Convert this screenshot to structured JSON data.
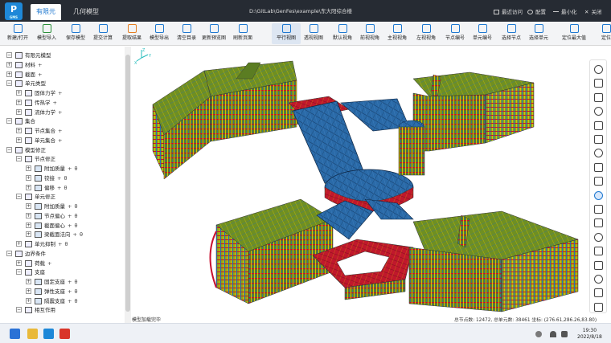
{
  "app": {
    "logo_text": "P",
    "logo_sub": "GMS",
    "tabs": [
      {
        "label": "有限元",
        "active": true
      },
      {
        "label": "几何模型",
        "active": false
      }
    ],
    "file_path": "D:\\GitLab\\GenFes\\example\\东大阳综合楼",
    "title_right": {
      "recent": "最近访问",
      "settings": "配置",
      "minimize": "最小化",
      "close": "关闭"
    }
  },
  "ribbon": {
    "buttons": [
      {
        "label": "新建/打开",
        "icon": "new-open-icon"
      },
      {
        "label": "模型导入",
        "icon": "import-icon"
      },
      {
        "label": "保存模型",
        "icon": "save-icon"
      },
      {
        "label": "提交计算",
        "icon": "submit-icon"
      },
      {
        "label": "提取结果",
        "icon": "extract-icon"
      },
      {
        "label": "模型导出",
        "icon": "export-icon"
      },
      {
        "label": "清空目录",
        "icon": "clear-icon"
      },
      {
        "label": "更新预览图",
        "icon": "update-preview-icon"
      },
      {
        "label": "刷新页面",
        "icon": "refresh-icon"
      },
      {
        "label": "平行视图",
        "icon": "parallel-view-icon"
      },
      {
        "label": "透视视图",
        "icon": "perspective-view-icon"
      },
      {
        "label": "默认视角",
        "icon": "default-view-icon"
      },
      {
        "label": "前视视角",
        "icon": "front-view-icon"
      },
      {
        "label": "主视视角",
        "icon": "main-view-icon"
      },
      {
        "label": "左视视角",
        "icon": "left-view-icon"
      },
      {
        "label": "节点编号",
        "icon": "node-number-icon"
      },
      {
        "label": "单元编号",
        "icon": "element-number-icon"
      },
      {
        "label": "选择节点",
        "icon": "select-node-icon"
      },
      {
        "label": "选择单元",
        "icon": "select-element-icon"
      },
      {
        "label": "定位最大值",
        "icon": "locate-max-icon"
      },
      {
        "label": "定位",
        "icon": "locate-icon"
      }
    ],
    "active_index": 9
  },
  "tree": {
    "items": [
      {
        "label": "有限元模型",
        "level": 0,
        "plus": false
      },
      {
        "label": "材料",
        "level": 0,
        "plus": true
      },
      {
        "label": "截面",
        "level": 0,
        "plus": true
      },
      {
        "label": "单元类型",
        "level": 0,
        "plus": false
      },
      {
        "label": "固体力学",
        "level": 1,
        "plus": true
      },
      {
        "label": "传热学",
        "level": 1,
        "plus": true
      },
      {
        "label": "流体力学",
        "level": 1,
        "plus": true
      },
      {
        "label": "集合",
        "level": 0,
        "plus": false
      },
      {
        "label": "节点集合",
        "level": 1,
        "plus": true
      },
      {
        "label": "单元集合",
        "level": 1,
        "plus": true
      },
      {
        "label": "模型修正",
        "level": 0,
        "plus": false
      },
      {
        "label": "节点修正",
        "level": 1,
        "plus": false
      },
      {
        "label": "附加质量",
        "level": 2,
        "plus": true,
        "extra": "θ"
      },
      {
        "label": "铰接",
        "level": 2,
        "plus": true,
        "extra": "θ"
      },
      {
        "label": "偏移",
        "level": 2,
        "plus": true,
        "extra": "θ"
      },
      {
        "label": "单元修正",
        "level": 1,
        "plus": false
      },
      {
        "label": "附加质量",
        "level": 2,
        "plus": true,
        "extra": "θ"
      },
      {
        "label": "节点偏心",
        "level": 2,
        "plus": true,
        "extra": "θ"
      },
      {
        "label": "截面偏心",
        "level": 2,
        "plus": true,
        "extra": "θ"
      },
      {
        "label": "梁截面法向",
        "level": 2,
        "plus": true,
        "extra": "θ"
      },
      {
        "label": "单元抑制",
        "level": 1,
        "plus": true,
        "extra": "θ"
      },
      {
        "label": "边界条件",
        "level": 0,
        "plus": false
      },
      {
        "label": "荷载",
        "level": 1,
        "plus": true
      },
      {
        "label": "支座",
        "level": 1,
        "plus": false
      },
      {
        "label": "固定支座",
        "level": 2,
        "plus": true,
        "extra": "θ"
      },
      {
        "label": "弹性支座",
        "level": 2,
        "plus": true,
        "extra": "θ"
      },
      {
        "label": "隔震支座",
        "level": 2,
        "plus": true,
        "extra": "θ"
      },
      {
        "label": "相互作用",
        "level": 1,
        "plus": false
      }
    ]
  },
  "viewport": {
    "axis_x": "X",
    "axis_y": "Y",
    "axis_z": "Z",
    "status_left": "模型加载完毕",
    "status_right": "总节点数: 12472, 总单元数: 38461   坐标: (276.61,286.26,83.80)"
  },
  "right_toolbar": {
    "icons": [
      "menu-icon",
      "layer-icon",
      "document-icon",
      "qr-grid-icon",
      "hand-icon",
      "ruler-icon",
      "rotate-icon",
      "box-icon",
      "tag-icon",
      "play-icon",
      "cube-icon",
      "cube-link-icon",
      "zoom-fit-icon",
      "frame-icon",
      "layers-stack-icon",
      "settings-icon",
      "reset-icon",
      "help-icon"
    ],
    "active_index": 9
  },
  "taskbar": {
    "time": "19:30",
    "date": "2022/8/18"
  },
  "colors": {
    "titlebar": "#262b33",
    "accent": "#1e78d0",
    "slab_blue": "#2e6fae",
    "facade_green": "#5b7d22",
    "beam_red": "#c8102e",
    "column_yellow": "#e6c800"
  }
}
